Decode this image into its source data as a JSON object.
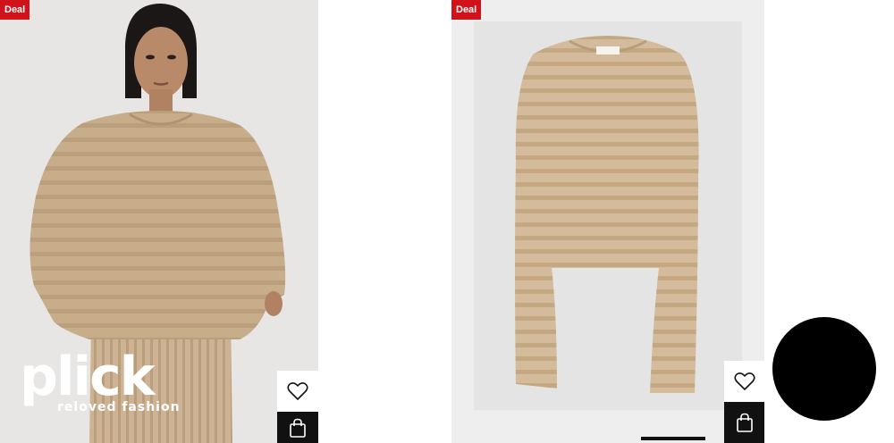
{
  "products": [
    {
      "badge": "Deal",
      "logo": {
        "word": "plick",
        "tagline": "reloved fashion"
      },
      "image_icon": "model-wearing-sweater",
      "wishlist_icon": "heart-icon",
      "bag_icon": "shopping-bag-icon"
    },
    {
      "badge": "Deal",
      "image_icon": "sweater-product-photo",
      "wishlist_icon": "heart-icon",
      "bag_icon": "shopping-bag-icon"
    }
  ],
  "colors": {
    "deal_badge": "#d0121b",
    "sweater": "#c9ad8a",
    "bag_button": "#111111"
  }
}
